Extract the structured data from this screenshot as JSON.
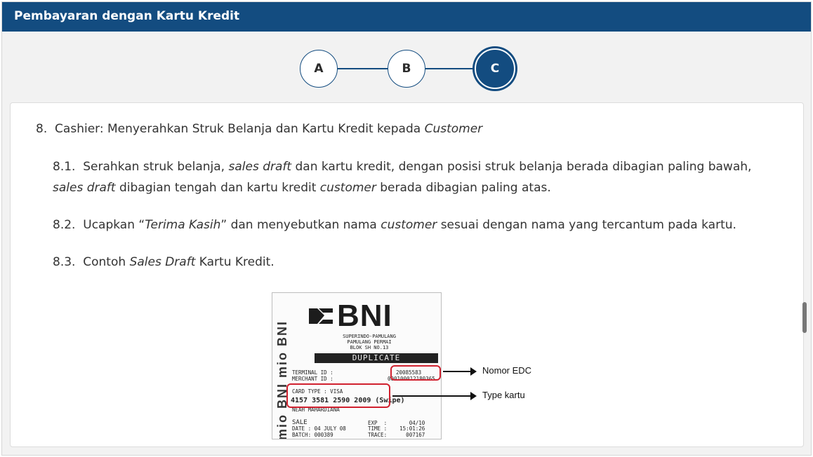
{
  "header": {
    "title": "Pembayaran dengan Kartu Kredit"
  },
  "stepper": {
    "steps": [
      {
        "label": "A",
        "active": false
      },
      {
        "label": "B",
        "active": false
      },
      {
        "label": "C",
        "active": true
      }
    ]
  },
  "content": {
    "heading": {
      "num": "8.",
      "text": "Cashier: Menyerahkan Struk Belanja dan Kartu Kredit kepada ",
      "italic": "Customer"
    },
    "items": [
      {
        "num": "8.1.",
        "parts": [
          {
            "t": "Serahkan struk belanja, "
          },
          {
            "t": "sales draft",
            "i": true
          },
          {
            "t": " dan kartu kredit, dengan posisi struk belanja berada  dibagian paling bawah, "
          },
          {
            "t": "sales draft",
            "i": true
          },
          {
            "t": " dibagian tengah dan kartu kredit "
          },
          {
            "t": "customer",
            "i": true
          },
          {
            "t": " berada dibagian paling atas."
          }
        ]
      },
      {
        "num": "8.2.",
        "parts": [
          {
            "t": "Ucapkan “"
          },
          {
            "t": "Terima Kasih",
            "i": true
          },
          {
            "t": "” dan menyebutkan nama "
          },
          {
            "t": "customer",
            "i": true
          },
          {
            "t": " sesuai dengan nama yang tercantum pada kartu."
          }
        ]
      },
      {
        "num": "8.3.",
        "parts": [
          {
            "t": "Contoh "
          },
          {
            "t": "Sales Draft",
            "i": true
          },
          {
            "t": " Kartu Kredit."
          }
        ]
      }
    ]
  },
  "receipt": {
    "side_text": "mio BNI mio BNI",
    "logo": "BNI",
    "store_lines": [
      "SUPERINDO-PAMULANG",
      "PAMULANG PERMAI",
      "BLOK SH NO.13"
    ],
    "duplicate": "DUPLICATE",
    "terminal_label": "TERMINAL ID :",
    "terminal_value": "20085583",
    "merchant_label": "MERCHANT ID :",
    "merchant_value": "000100012180365",
    "card_type": "CARD TYPE : VISA",
    "pan": "4157 3581 2590 2009 (Swipe)",
    "holder": "NEAH MAHARDIANA",
    "sale": "SALE",
    "exp": "EXP  :       04/10",
    "date": "DATE : 04 JULY 08",
    "time": "TIME :    15:01:26",
    "batch": "BATCH: 000389",
    "trace": "TRACE:      007167"
  },
  "annotations": {
    "edc_label": "Nomor EDC",
    "card_label": "Type kartu"
  },
  "colors": {
    "header_bg": "#134c80",
    "highlight_box": "#d0202e"
  }
}
